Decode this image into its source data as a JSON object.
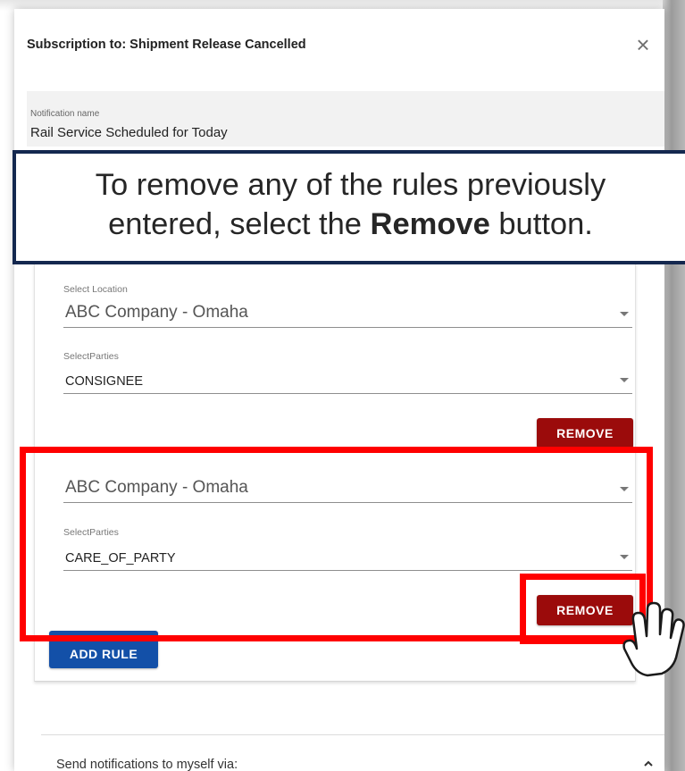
{
  "dialog": {
    "title": "Subscription to: Shipment Release Cancelled",
    "close_glyph": "×"
  },
  "notification": {
    "label": "Notification name",
    "value": "Rail Service Scheduled for Today"
  },
  "callout": {
    "line1": "To remove any of the rules previously",
    "line2_pre": "entered, select the ",
    "line2_bold": "Remove",
    "line2_post": " button."
  },
  "rules": [
    {
      "location_label": "Select Location",
      "location_value": "ABC Company - Omaha",
      "parties_label": "SelectParties",
      "parties_value": "CONSIGNEE",
      "remove_label": "REMOVE"
    },
    {
      "location_value": "ABC Company - Omaha",
      "parties_label": "SelectParties",
      "parties_value": "CARE_OF_PARTY",
      "remove_label": "REMOVE"
    }
  ],
  "add_rule_label": "ADD RULE",
  "send_section": {
    "label": "Send notifications to myself via:",
    "chevron_glyph": "^"
  },
  "icons": {
    "close": "close-icon",
    "dropdown": "chevron-down-icon",
    "collapse": "chevron-up-icon",
    "pointer": "hand-pointer-icon"
  },
  "colors": {
    "remove_button": "#9b0b0b",
    "add_rule_button": "#1350a8",
    "highlight": "#ff0000",
    "callout_border": "#14284f"
  }
}
